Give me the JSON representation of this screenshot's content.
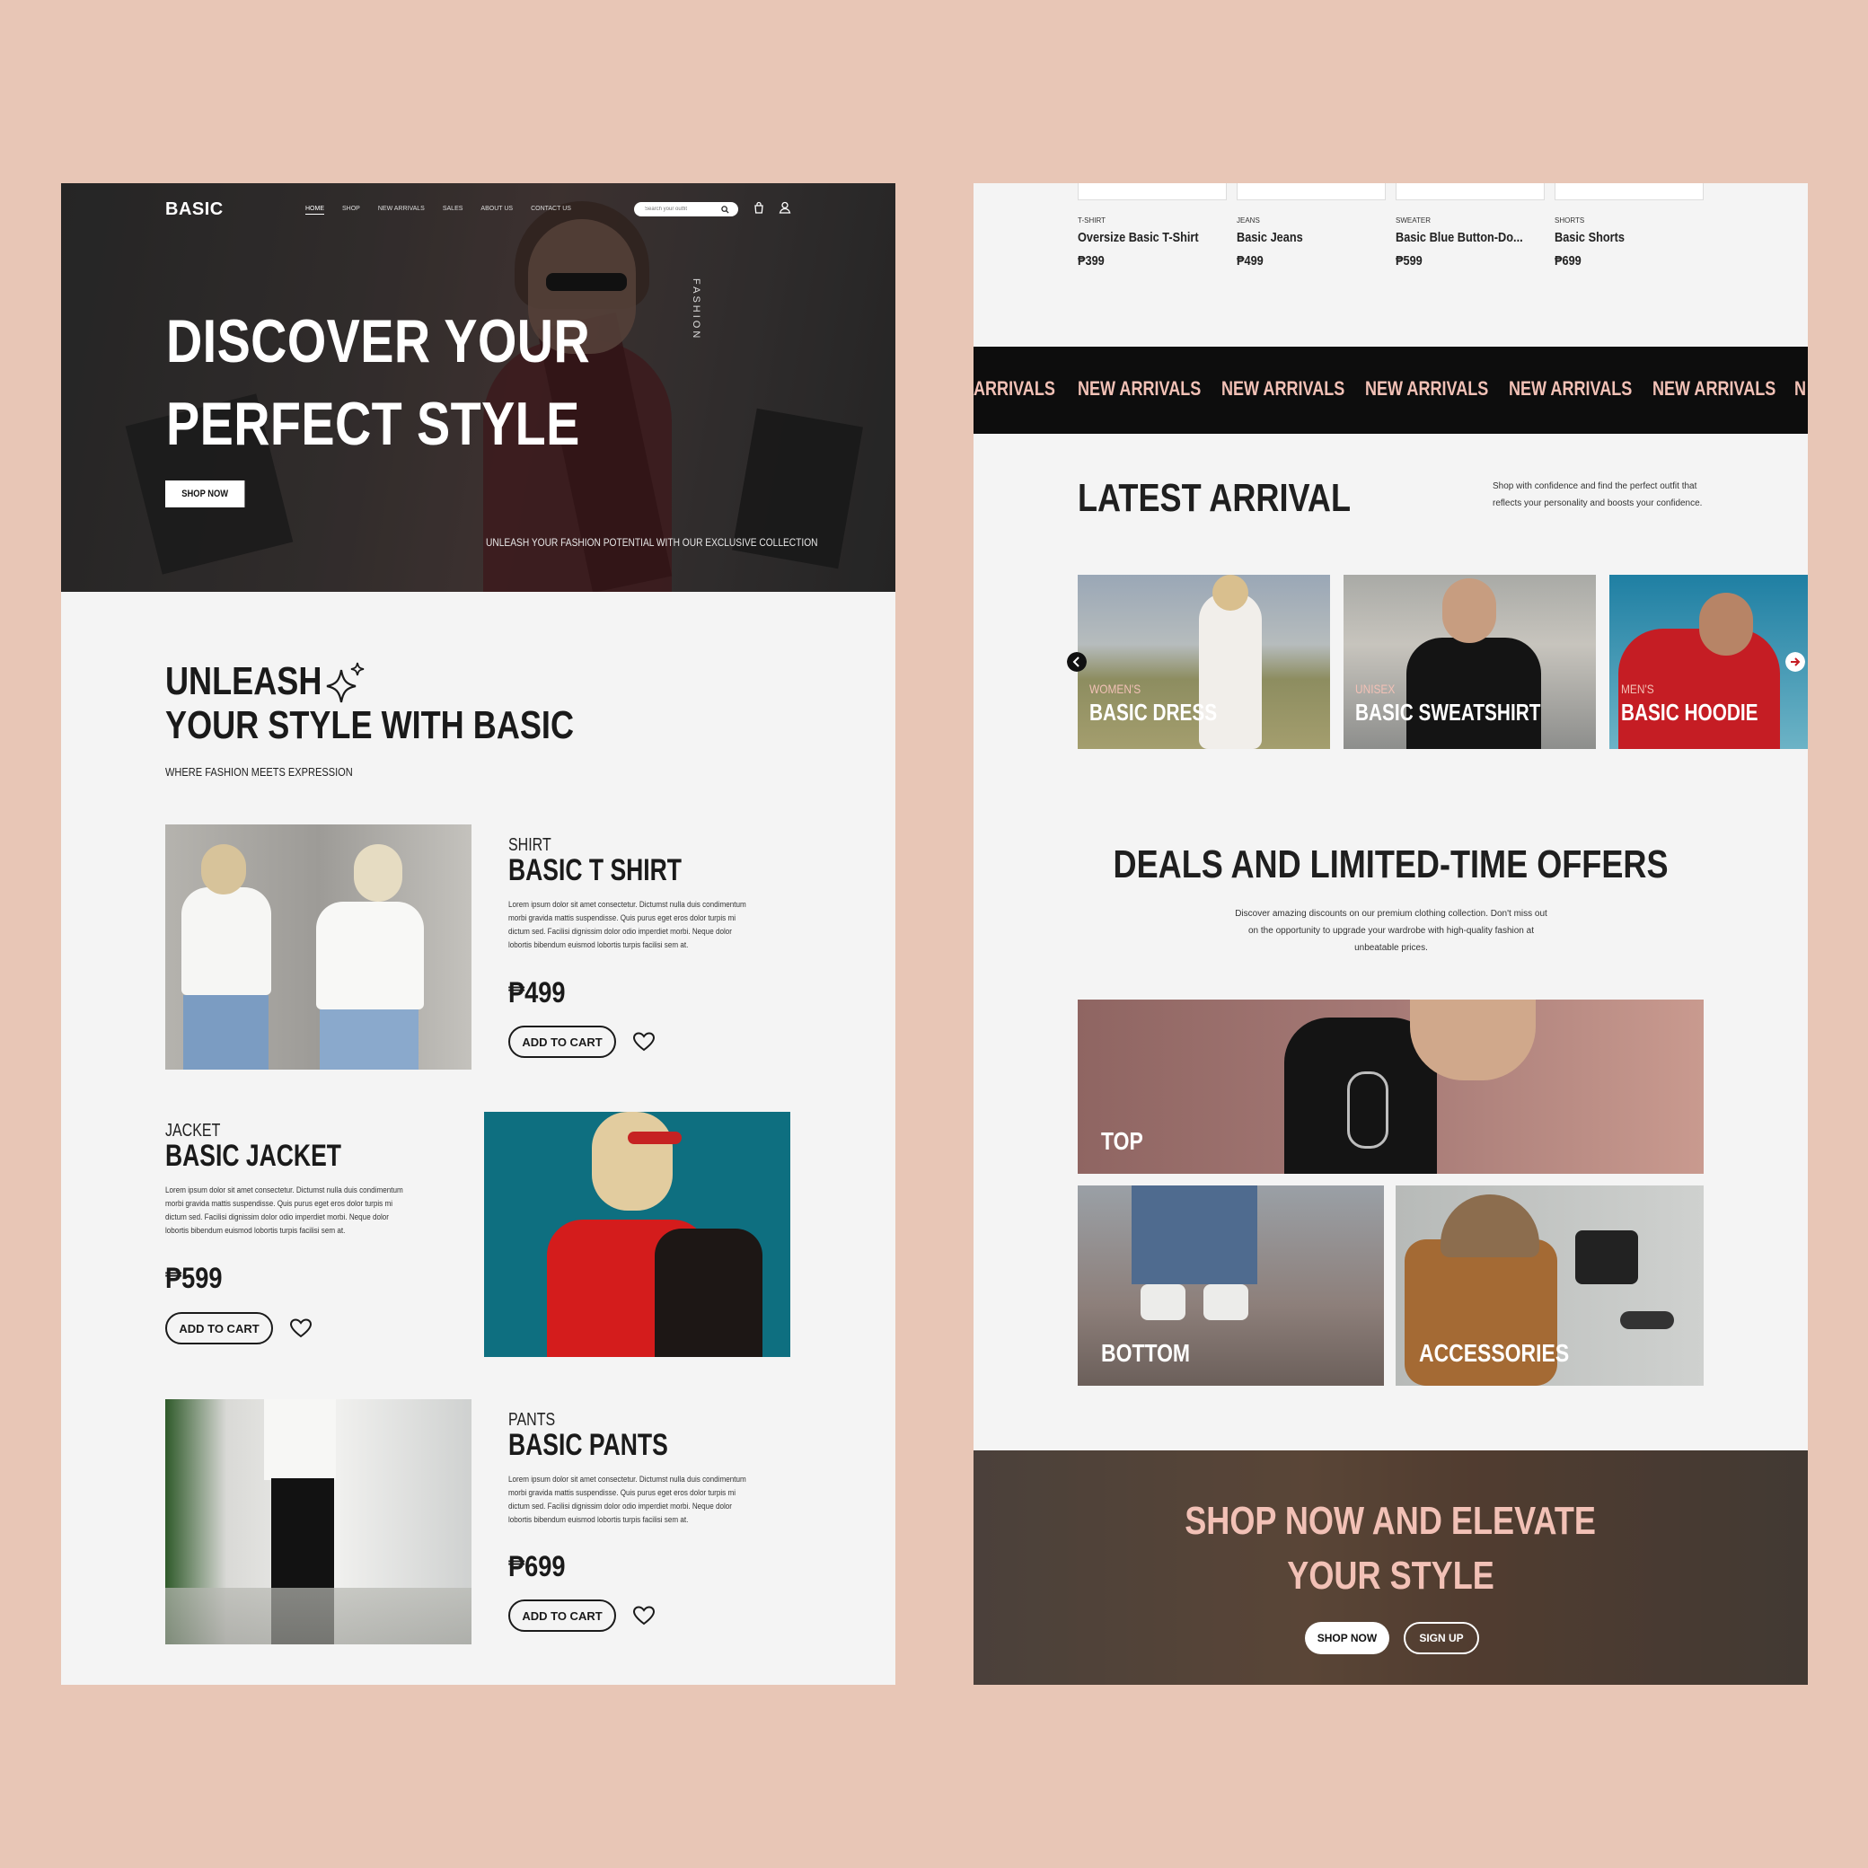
{
  "left": {
    "brand": "BASIC",
    "nav": [
      "HOME",
      "SHOP",
      "NEW ARRIVALS",
      "SALES",
      "ABOUT US",
      "CONTACT US"
    ],
    "search_placeholder": "Search your outfit",
    "hero": {
      "title_line1": "DISCOVER YOUR",
      "title_line2": "PERFECT STYLE",
      "cta": "SHOP NOW",
      "side_label": "FASHION",
      "tagline": "UNLEASH YOUR FASHION POTENTIAL WITH OUR EXCLUSIVE COLLECTION"
    },
    "intro": {
      "line1": "UNLEASH",
      "line2": "YOUR STYLE WITH BASIC",
      "tagline": "WHERE FASHION MEETS EXPRESSION"
    },
    "products": [
      {
        "category": "SHIRT",
        "name": "BASIC T SHIRT",
        "desc": "Lorem ipsum dolor sit amet consectetur. Dictumst nulla duis condimentum morbi gravida mattis suspendisse. Quis purus eget eros dolor turpis mi dictum sed. Facilisi dignissim dolor odio imperdiet morbi. Neque dolor lobortis bibendum euismod lobortis turpis facilisi sem at.",
        "price": "₱499",
        "button": "ADD TO CART"
      },
      {
        "category": "JACKET",
        "name": "BASIC JACKET",
        "desc": "Lorem ipsum dolor sit amet consectetur. Dictumst nulla duis condimentum morbi gravida mattis suspendisse. Quis purus eget eros dolor turpis mi dictum sed. Facilisi dignissim dolor odio imperdiet morbi. Neque dolor lobortis bibendum euismod lobortis turpis facilisi sem at.",
        "price": "₱599",
        "button": "ADD TO CART"
      },
      {
        "category": "PANTS",
        "name": "BASIC PANTS",
        "desc": "Lorem ipsum dolor sit amet consectetur. Dictumst nulla duis condimentum morbi gravida mattis suspendisse. Quis purus eget eros dolor turpis mi dictum sed. Facilisi dignissim dolor odio imperdiet morbi. Neque dolor lobortis bibendum euismod lobortis turpis facilisi sem at.",
        "price": "₱699",
        "button": "ADD TO CART"
      }
    ]
  },
  "right": {
    "thumbs": [
      {
        "category": "T-SHIRT",
        "name": "Oversize Basic T-Shirt",
        "price": "₱399"
      },
      {
        "category": "JEANS",
        "name": "Basic Jeans",
        "price": "₱499"
      },
      {
        "category": "SWEATER",
        "name": "Basic Blue Button-Do...",
        "price": "₱599"
      },
      {
        "category": "SHORTS",
        "name": "Basic Shorts",
        "price": "₱699"
      }
    ],
    "ticker": [
      "ARRIVALS",
      "NEW ARRIVALS",
      "NEW ARRIVALS",
      "NEW ARRIVALS",
      "NEW ARRIVALS",
      "NEW ARRIVALS",
      "N"
    ],
    "latest": {
      "title": "LATEST ARRIVAL",
      "desc": "Shop with confidence and find the perfect outfit that reflects your personality and boosts your confidence.",
      "cards": [
        {
          "category": "WOMEN'S",
          "name": "BASIC DRESS"
        },
        {
          "category": "UNISEX",
          "name": "BASIC SWEATSHIRT"
        },
        {
          "category": "MEN'S",
          "name": "BASIC HOODIE"
        }
      ]
    },
    "deals": {
      "title": "DEALS AND LIMITED-TIME OFFERS",
      "desc": "Discover amazing discounts on our premium clothing collection. Don't miss out on the opportunity to upgrade your wardrobe with high-quality fashion at unbeatable prices.",
      "tiles": [
        "TOP",
        "BOTTOM",
        "ACCESSORIES"
      ]
    },
    "cta": {
      "line1": "SHOP NOW AND ELEVATE",
      "line2": "YOUR STYLE",
      "primary": "SHOP NOW",
      "secondary": "SIGN UP"
    }
  },
  "colors": {
    "background": "#e8c6b6",
    "panel": "#f4f4f4",
    "ink": "#1a1a1a",
    "accent_pink": "#f2c1b6",
    "ticker_bg": "#0d0d0d"
  }
}
